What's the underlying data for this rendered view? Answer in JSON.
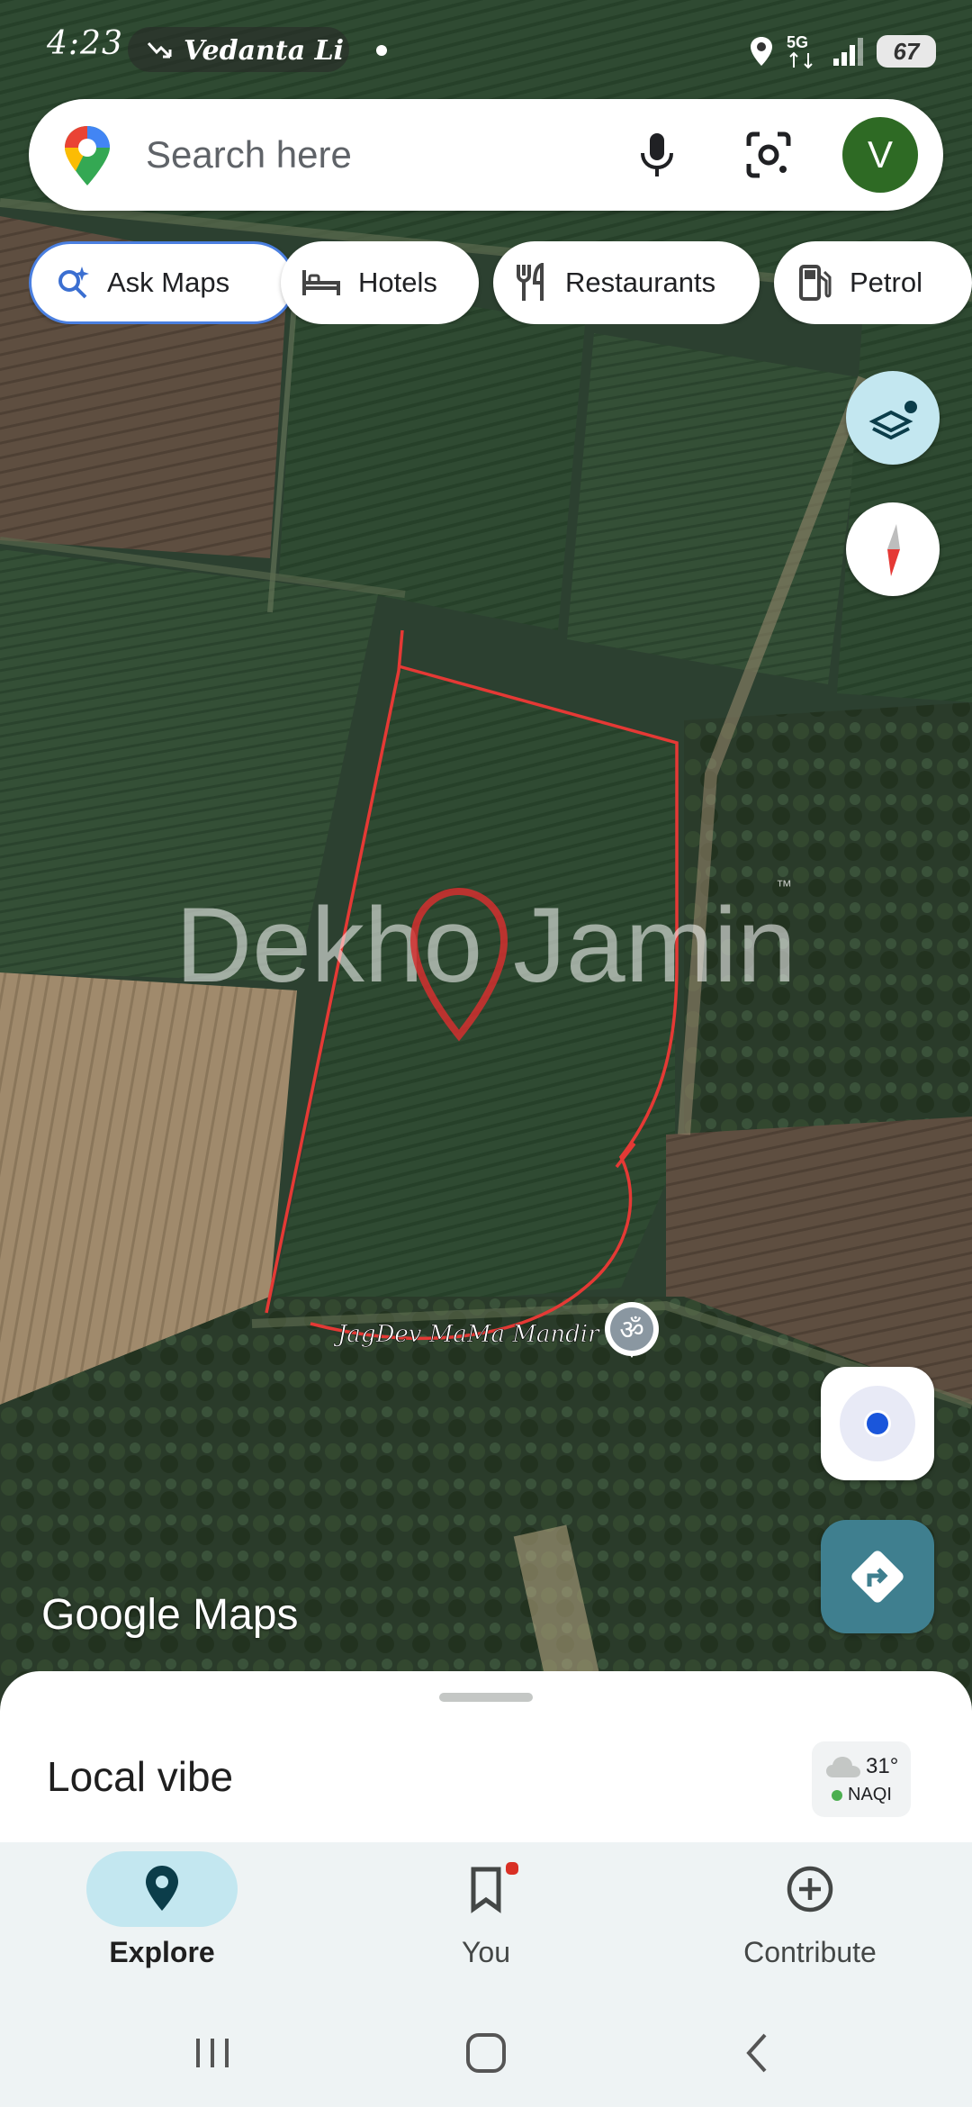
{
  "status_bar": {
    "time": "4:23",
    "notification_text": "Vedanta Li",
    "network": "5G",
    "battery": "67"
  },
  "search": {
    "placeholder": "Search here",
    "avatar_letter": "V"
  },
  "chips": [
    {
      "label": "Ask Maps",
      "icon": "ask-maps-sparkle-icon"
    },
    {
      "label": "Hotels",
      "icon": "bed-icon"
    },
    {
      "label": "Restaurants",
      "icon": "fork-knife-icon"
    },
    {
      "label": "Petrol",
      "icon": "fuel-pump-icon"
    }
  ],
  "map": {
    "watermark": "Dekho Jamin",
    "watermark_tm": "™",
    "place_label": "JagDev MaMa Mandir",
    "place_icon": "om-temple-icon",
    "logo_google": "Google",
    "logo_maps": "Maps",
    "boundary_color": "#e53935"
  },
  "sheet": {
    "title": "Local vibe",
    "temperature": "31°",
    "aqi_label": "NAQI"
  },
  "bottom_nav": {
    "explore": "Explore",
    "you": "You",
    "contribute": "Contribute"
  },
  "colors": {
    "accent": "#4a7fe0",
    "nav_active": "#c3e7f0",
    "directions": "#3f7f8f",
    "avatar": "#2e6a24"
  }
}
